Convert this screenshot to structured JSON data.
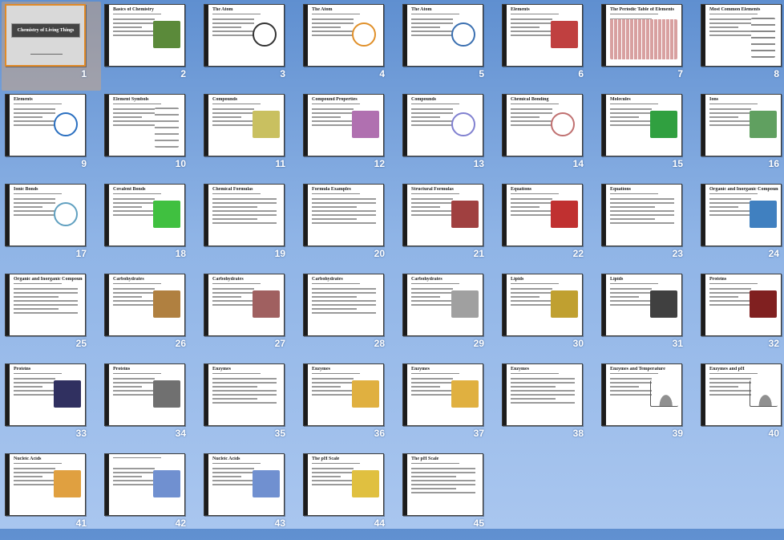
{
  "app": {
    "view": "Slide Sorter"
  },
  "selected_slide": 1,
  "slides": [
    {
      "n": "1",
      "title": "Chemistry of Living Things",
      "kind": "title"
    },
    {
      "n": "2",
      "title": "Basics of Chemistry",
      "kind": "photo",
      "c": "#5b8a3a"
    },
    {
      "n": "3",
      "title": "The Atom",
      "kind": "atom",
      "c": "#333333"
    },
    {
      "n": "4",
      "title": "The Atom",
      "kind": "atom",
      "c": "#e0902a"
    },
    {
      "n": "5",
      "title": "The Atom",
      "kind": "atom",
      "c": "#3a6fb0"
    },
    {
      "n": "6",
      "title": "Elements",
      "kind": "photo",
      "c": "#c04040"
    },
    {
      "n": "7",
      "title": "The Periodic Table of Elements",
      "kind": "table",
      "c": "#d8a0a0"
    },
    {
      "n": "8",
      "title": "Most Common Elements",
      "kind": "list",
      "c": "#888888"
    },
    {
      "n": "9",
      "title": "Elements",
      "kind": "atom",
      "c": "#2a6fc0"
    },
    {
      "n": "10",
      "title": "Element Symbols",
      "kind": "list",
      "c": "#999999"
    },
    {
      "n": "11",
      "title": "Compounds",
      "kind": "photo",
      "c": "#c9c060"
    },
    {
      "n": "12",
      "title": "Compound Properties",
      "kind": "photo",
      "c": "#b070b0"
    },
    {
      "n": "13",
      "title": "Compounds",
      "kind": "atom",
      "c": "#8080d0"
    },
    {
      "n": "14",
      "title": "Chemical Bonding",
      "kind": "atom",
      "c": "#c07070"
    },
    {
      "n": "15",
      "title": "Molecules",
      "kind": "photo",
      "c": "#30a040"
    },
    {
      "n": "16",
      "title": "Ions",
      "kind": "photo",
      "c": "#60a060"
    },
    {
      "n": "17",
      "title": "Ionic Bonds",
      "kind": "atom",
      "c": "#60a0c0"
    },
    {
      "n": "18",
      "title": "Covalent Bonds",
      "kind": "photo",
      "c": "#40c040"
    },
    {
      "n": "19",
      "title": "Chemical Formulas",
      "kind": "text",
      "c": "#999999"
    },
    {
      "n": "20",
      "title": "Formula Examples",
      "kind": "text",
      "c": "#999999"
    },
    {
      "n": "21",
      "title": "Structural Formulas",
      "kind": "photo",
      "c": "#a04040"
    },
    {
      "n": "22",
      "title": "Equations",
      "kind": "photo",
      "c": "#c03030"
    },
    {
      "n": "23",
      "title": "Equations",
      "kind": "text",
      "c": "#999999"
    },
    {
      "n": "24",
      "title": "Organic and Inorganic Compounds",
      "kind": "photo",
      "c": "#4080c0"
    },
    {
      "n": "25",
      "title": "Organic and Inorganic Compounds",
      "kind": "text",
      "c": "#999999"
    },
    {
      "n": "26",
      "title": "Carbohydrates",
      "kind": "photo",
      "c": "#b08040"
    },
    {
      "n": "27",
      "title": "Carbohydrates",
      "kind": "photo",
      "c": "#a06060"
    },
    {
      "n": "28",
      "title": "Carbohydrates",
      "kind": "text",
      "c": "#999999"
    },
    {
      "n": "29",
      "title": "Carbohydrates",
      "kind": "photo",
      "c": "#a0a0a0"
    },
    {
      "n": "30",
      "title": "Lipids",
      "kind": "photo",
      "c": "#c0a030"
    },
    {
      "n": "31",
      "title": "Lipids",
      "kind": "photo",
      "c": "#404040"
    },
    {
      "n": "32",
      "title": "Proteins",
      "kind": "photo",
      "c": "#802020"
    },
    {
      "n": "33",
      "title": "Proteins",
      "kind": "photo",
      "c": "#303060"
    },
    {
      "n": "34",
      "title": "Proteins",
      "kind": "photo",
      "c": "#707070"
    },
    {
      "n": "35",
      "title": "Enzymes",
      "kind": "text",
      "c": "#999999"
    },
    {
      "n": "36",
      "title": "Enzymes",
      "kind": "photo",
      "c": "#e0b040"
    },
    {
      "n": "37",
      "title": "Enzymes",
      "kind": "photo",
      "c": "#e0b040"
    },
    {
      "n": "38",
      "title": "Enzymes",
      "kind": "text",
      "c": "#999999"
    },
    {
      "n": "39",
      "title": "Enzymes and Temperature",
      "kind": "chart",
      "c": "#909090"
    },
    {
      "n": "40",
      "title": "Enzymes and pH",
      "kind": "chart",
      "c": "#909090"
    },
    {
      "n": "41",
      "title": "Nucleic Acids",
      "kind": "photo",
      "c": "#e0a040"
    },
    {
      "n": "42",
      "title": "",
      "kind": "photo",
      "c": "#7090d0"
    },
    {
      "n": "43",
      "title": "Nucleic Acids",
      "kind": "photo",
      "c": "#7090d0"
    },
    {
      "n": "44",
      "title": "The pH Scale",
      "kind": "photo",
      "c": "#e0c040"
    },
    {
      "n": "45",
      "title": "The pH Scale",
      "kind": "text",
      "c": "#999999"
    }
  ]
}
